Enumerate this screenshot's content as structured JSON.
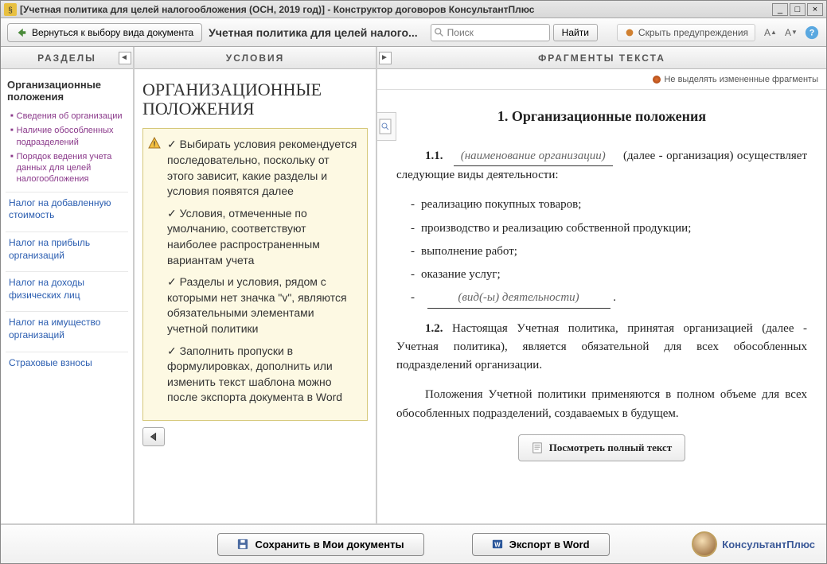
{
  "window": {
    "title": "[Учетная политика для целей налогообложения (ОСН, 2019 год)] - Конструктор договоров КонсультантПлюс"
  },
  "toolbar": {
    "back": "Вернуться к выбору вида документа",
    "doc_title": "Учетная политика для целей налого...",
    "search_placeholder": "Поиск",
    "find": "Найти",
    "hide_warnings": "Скрыть предупреждения"
  },
  "columns": {
    "sections": "РАЗДЕЛЫ",
    "conditions": "УСЛОВИЯ",
    "fragments": "ФРАГМЕНТЫ ТЕКСТА"
  },
  "sidebar": {
    "active": "Организационные положения",
    "subs": [
      "Сведения об организации",
      "Наличие обособленных подразделений",
      "Порядок ведения учета данных для целей налогообложения"
    ],
    "links": [
      "Налог на добавленную стоимость",
      "Налог на прибыль организаций",
      "Налог на доходы физических лиц",
      "Налог на имущество организаций",
      "Страховые взносы"
    ]
  },
  "conditions": {
    "title": "ОРГАНИЗАЦИОННЫЕ ПОЛОЖЕНИЯ",
    "tips": [
      "✓ Выбирать условия рекомендуется последовательно, поскольку от этого зависит, какие разделы и условия появятся далее",
      "✓ Условия, отмеченные по умолчанию, соответствуют наиболее распространенным вариантам учета",
      "✓ Разделы и условия, рядом с которыми нет значка \"v\", являются обязательными элементами учетной политики",
      "✓ Заполнить пропуски в формулировках, дополнить или изменить текст шаблона можно после экспорта документа в Word"
    ]
  },
  "fragments": {
    "no_highlight": "Не выделять измененные фрагменты",
    "heading": "1.  Организационные положения",
    "p11_num": "1.1.",
    "p11_fill": "(наименование организации)",
    "p11_tail": "(далее - организация) осуществляет следующие виды деятельности:",
    "activities": [
      "реализацию покупных товаров;",
      "производство и реализацию собственной продукции;",
      "выполнение работ;",
      "оказание услуг;"
    ],
    "activity_blank": "(вид(-ы) деятельности)",
    "p12_num": "1.2.",
    "p12_text": "Настоящая Учетная политика, принятая организацией (далее - Учетная политика), является обязательной для всех обособленных подразделений организации.",
    "p_extra": "Положения Учетной политики  применяются в полном объеме для  всех обособленных подразделений, создаваемых в будущем.",
    "view_full": "Посмотреть полный текст"
  },
  "footer": {
    "save": "Сохранить в Мои документы",
    "export": "Экспорт в Word",
    "brand": "КонсультантПлюс"
  }
}
